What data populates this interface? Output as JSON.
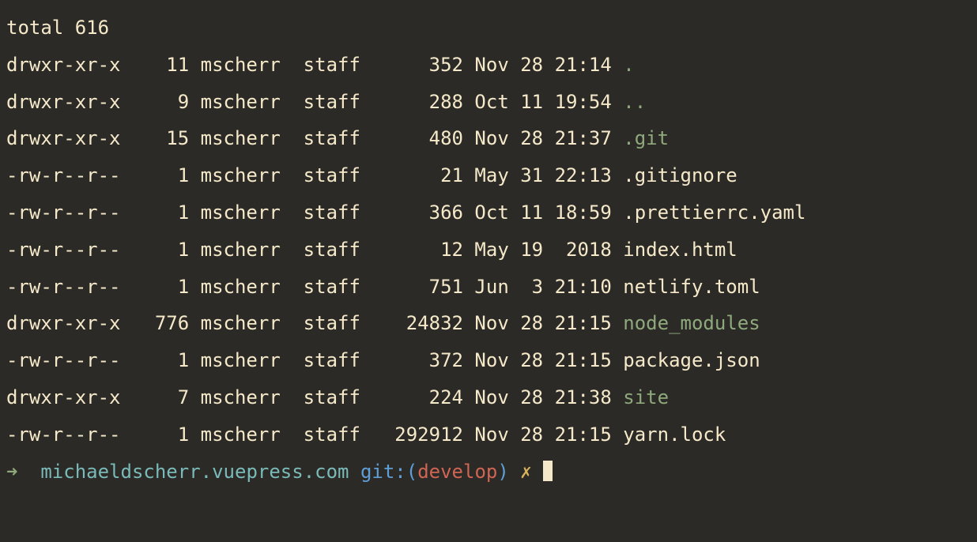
{
  "total_label": "total",
  "total_value": "616",
  "entries": [
    {
      "perms": "drwxr-xr-x",
      "links": "11",
      "owner": "mscherr",
      "group": "staff",
      "size": "352",
      "date": "Nov 28 21:14",
      "name": ".",
      "is_dir": true
    },
    {
      "perms": "drwxr-xr-x",
      "links": "9",
      "owner": "mscherr",
      "group": "staff",
      "size": "288",
      "date": "Oct 11 19:54",
      "name": "..",
      "is_dir": true
    },
    {
      "perms": "drwxr-xr-x",
      "links": "15",
      "owner": "mscherr",
      "group": "staff",
      "size": "480",
      "date": "Nov 28 21:37",
      "name": ".git",
      "is_dir": true
    },
    {
      "perms": "-rw-r--r--",
      "links": "1",
      "owner": "mscherr",
      "group": "staff",
      "size": "21",
      "date": "May 31 22:13",
      "name": ".gitignore",
      "is_dir": false
    },
    {
      "perms": "-rw-r--r--",
      "links": "1",
      "owner": "mscherr",
      "group": "staff",
      "size": "366",
      "date": "Oct 11 18:59",
      "name": ".prettierrc.yaml",
      "is_dir": false
    },
    {
      "perms": "-rw-r--r--",
      "links": "1",
      "owner": "mscherr",
      "group": "staff",
      "size": "12",
      "date": "May 19  2018",
      "name": "index.html",
      "is_dir": false
    },
    {
      "perms": "-rw-r--r--",
      "links": "1",
      "owner": "mscherr",
      "group": "staff",
      "size": "751",
      "date": "Jun  3 21:10",
      "name": "netlify.toml",
      "is_dir": false
    },
    {
      "perms": "drwxr-xr-x",
      "links": "776",
      "owner": "mscherr",
      "group": "staff",
      "size": "24832",
      "date": "Nov 28 21:15",
      "name": "node_modules",
      "is_dir": true
    },
    {
      "perms": "-rw-r--r--",
      "links": "1",
      "owner": "mscherr",
      "group": "staff",
      "size": "372",
      "date": "Nov 28 21:15",
      "name": "package.json",
      "is_dir": false
    },
    {
      "perms": "drwxr-xr-x",
      "links": "7",
      "owner": "mscherr",
      "group": "staff",
      "size": "224",
      "date": "Nov 28 21:38",
      "name": "site",
      "is_dir": true
    },
    {
      "perms": "-rw-r--r--",
      "links": "1",
      "owner": "mscherr",
      "group": "staff",
      "size": "292912",
      "date": "Nov 28 21:15",
      "name": "yarn.lock",
      "is_dir": false
    }
  ],
  "prompt": {
    "arrow": "➜ ",
    "path": "michaeldscherr.vuepress.com",
    "git_label": "git:",
    "paren_open": "(",
    "branch": "develop",
    "paren_close": ")",
    "dirty": "✗"
  }
}
